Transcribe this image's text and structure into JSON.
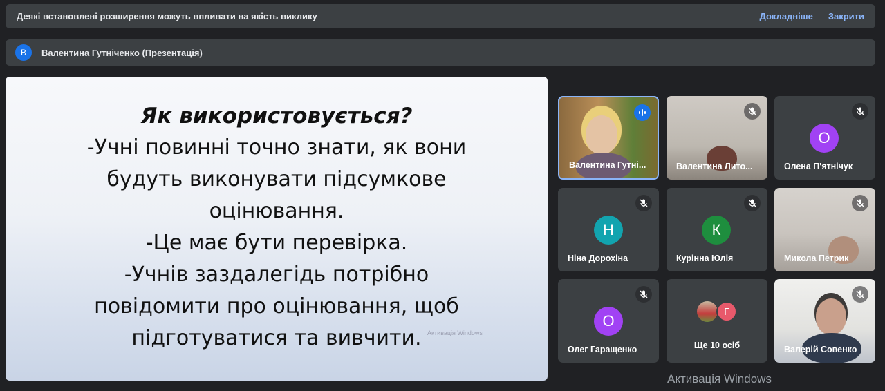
{
  "banner": {
    "text": "Деякі встановлені розширення можуть впливати на якість виклику",
    "details_label": "Докладніше",
    "close_label": "Закрити"
  },
  "presenter": {
    "initial": "В",
    "name": "Валентина Гутніченко (Презентація)"
  },
  "slide": {
    "title": "Як використовується?",
    "lines": [
      "-Учні повинні точно знати, як вони",
      "будуть виконувати підсумкове",
      "оцінювання.",
      "-Це має бути перевірка.",
      "-Учнів заздалегідь потрібно",
      "повідомити про оцінювання, щоб",
      "підготуватися та вивчити."
    ],
    "watermark": "Активація Windows"
  },
  "participants": [
    {
      "name": "Валентина Гутні...",
      "type": "video",
      "speaking": true
    },
    {
      "name": "Валентина Лито...",
      "type": "video",
      "muted": true
    },
    {
      "name": "Олена П'ятнічук",
      "type": "avatar",
      "initial": "О",
      "color": "#a142f4",
      "muted": true
    },
    {
      "name": "Ніна Дорохіна",
      "type": "avatar",
      "initial": "Н",
      "color": "#12a4af",
      "muted": true
    },
    {
      "name": "Курінна Юлія",
      "type": "avatar",
      "initial": "К",
      "color": "#1e8e3e",
      "muted": true
    },
    {
      "name": "Микола Петрик",
      "type": "video",
      "muted": true
    },
    {
      "name": "Олег Гаращенко",
      "type": "avatar",
      "initial": "О",
      "color": "#a142f4",
      "muted": true
    },
    {
      "name": "Ще 10 осіб",
      "type": "more",
      "initial": "Г",
      "color": "#e8596b"
    },
    {
      "name": "Валерій Совенко",
      "type": "video",
      "muted": true
    }
  ],
  "windows_watermark": "Активація Windows"
}
